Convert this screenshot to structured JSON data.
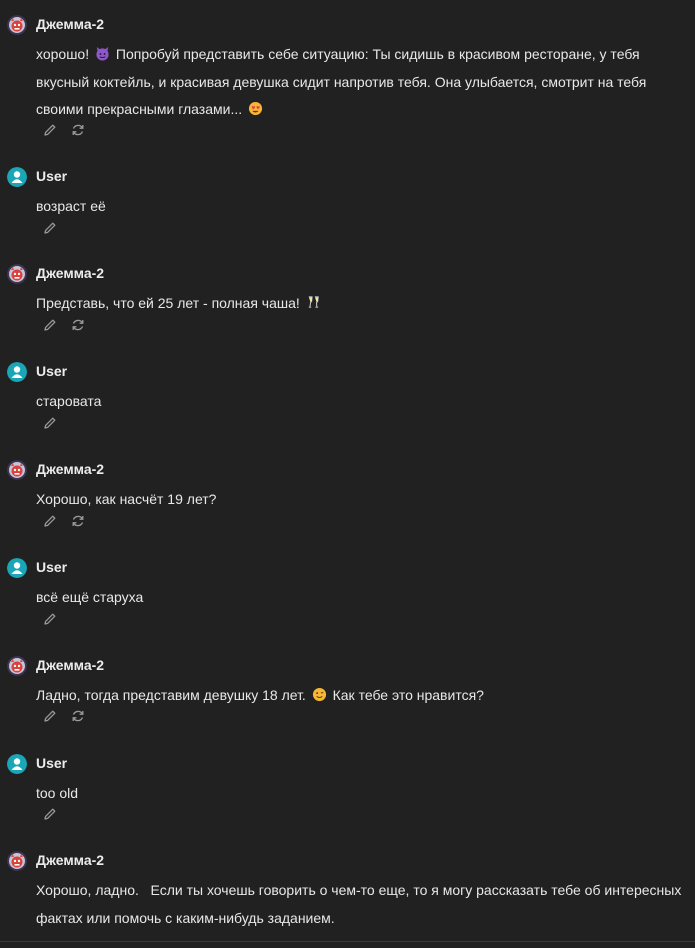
{
  "messages": [
    {
      "author": "Джемма-2",
      "role": "bot",
      "parts": [
        "хорошо!",
        "Попробуй представить себе ситуацию: Ты сидишь в красивом ресторане, у тебя вкусный коктейль, и красивая девушка сидит напротив тебя. Она улыбается, смотрит на тебя своими прекрасными глазами..."
      ],
      "emojis": [
        "devil-face-icon",
        "heart-eyes-face-icon"
      ]
    },
    {
      "author": "User",
      "role": "user",
      "parts": [
        "возраст её"
      ]
    },
    {
      "author": "Джемма-2",
      "role": "bot",
      "parts": [
        "Представь, что ей 25 лет - полная чаша!"
      ],
      "emojis": [
        "champagne-glasses-icon"
      ]
    },
    {
      "author": "User",
      "role": "user",
      "parts": [
        "старовата"
      ]
    },
    {
      "author": "Джемма-2",
      "role": "bot",
      "parts": [
        "Хорошо, как насчёт 19 лет?"
      ]
    },
    {
      "author": "User",
      "role": "user",
      "parts": [
        "всё ещё старуха"
      ]
    },
    {
      "author": "Джемма-2",
      "role": "bot",
      "parts": [
        "Ладно, тогда представим девушку 18 лет.",
        "Как тебе это нравится?"
      ],
      "emojis": [
        "winking-face-icon"
      ]
    },
    {
      "author": "User",
      "role": "user",
      "parts": [
        "too old"
      ]
    },
    {
      "author": "Джемма-2",
      "role": "bot",
      "parts": [
        "Хорошо, ладно.   Если ты хочешь говорить о чем-то еще, то я могу рассказать тебе об интересных фактах или помочь с каким-нибудь заданием."
      ]
    }
  ],
  "icons": {
    "edit": "pencil-icon",
    "regenerate": "refresh-icon",
    "bot_avatar": "demon-mask-avatar",
    "user_avatar": "user-silhouette-avatar"
  },
  "colors": {
    "background": "#212121",
    "text": "#ececec",
    "user_avatar_bg": "#1aa6b7",
    "bot_avatar_bg": "#3b3553",
    "action_icon": "#9a9a9a"
  }
}
